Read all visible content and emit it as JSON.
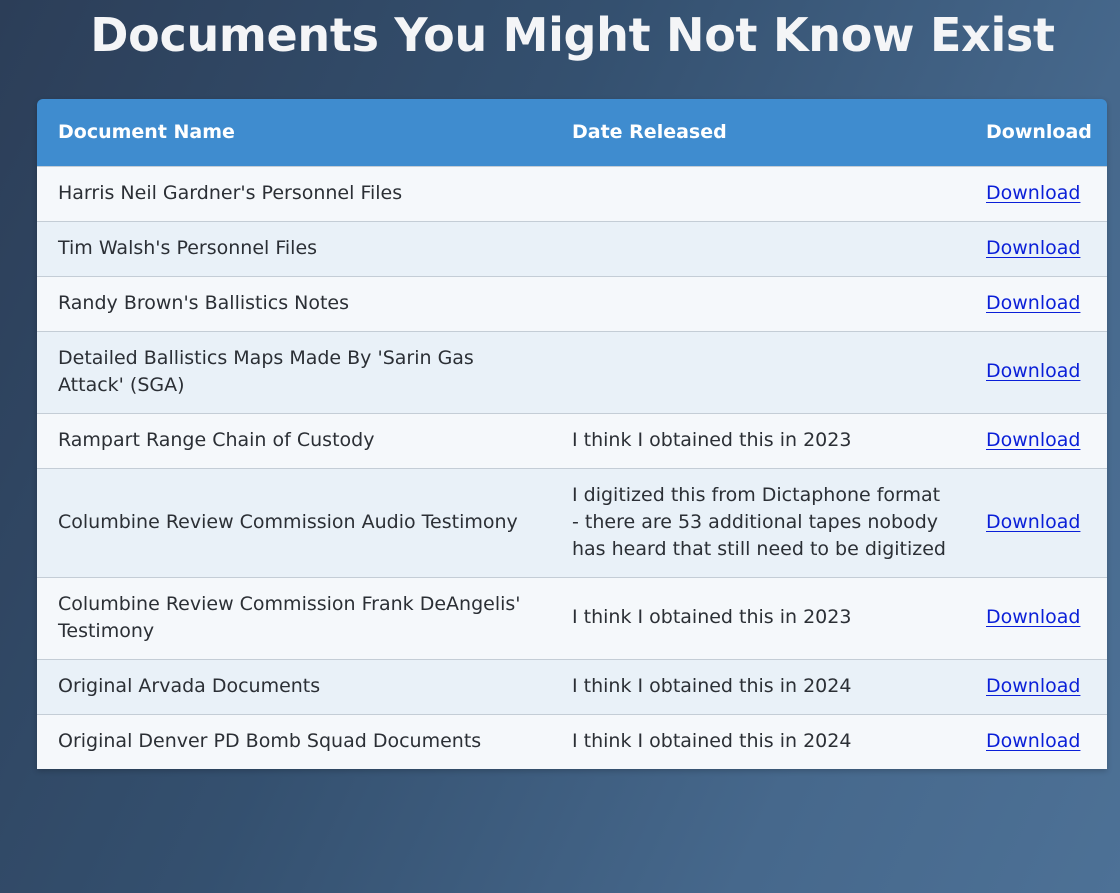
{
  "page": {
    "title": "Documents You Might Not Know Exist"
  },
  "table": {
    "headers": {
      "name": "Document Name",
      "date": "Date Released",
      "download": "Download"
    },
    "rows": [
      {
        "name": "Harris Neil Gardner's Personnel Files",
        "date": "",
        "link": "Download"
      },
      {
        "name": "Tim Walsh's Personnel Files",
        "date": "",
        "link": "Download"
      },
      {
        "name": "Randy Brown's Ballistics Notes",
        "date": "",
        "link": "Download"
      },
      {
        "name": "Detailed Ballistics Maps Made By 'Sarin Gas Attack' (SGA)",
        "date": "",
        "link": "Download"
      },
      {
        "name": "Rampart Range Chain of Custody",
        "date": "I think I obtained this in 2023",
        "link": "Download"
      },
      {
        "name": "Columbine Review Commission Audio Testimony",
        "date": "I digitized this from Dictaphone format - there are 53 additional tapes nobody has heard that still need to be digitized",
        "link": "Download"
      },
      {
        "name": "Columbine Review Commission Frank DeAngelis' Testimony",
        "date": "I think I obtained this in 2023",
        "link": "Download"
      },
      {
        "name": "Original Arvada Documents",
        "date": "I think I obtained this in 2024",
        "link": "Download"
      },
      {
        "name": "Original Denver PD Bomb Squad Documents",
        "date": "I think I obtained this in 2024",
        "link": "Download"
      }
    ]
  },
  "colors": {
    "header_bg": "#3f8ccf",
    "row_odd": "#f5f8fb",
    "row_even": "#e9f1f8",
    "link": "#0a1fd8",
    "title_text": "#f4f5f7"
  }
}
